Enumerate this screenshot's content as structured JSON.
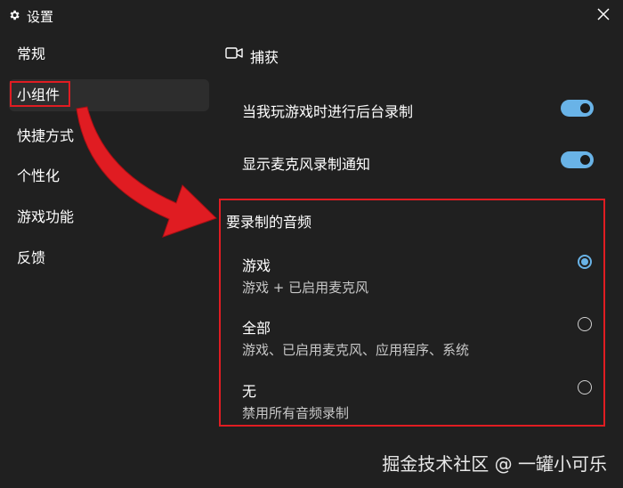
{
  "window": {
    "title": "设置"
  },
  "sidebar": {
    "items": [
      {
        "label": "常规"
      },
      {
        "label": "小组件"
      },
      {
        "label": "快捷方式"
      },
      {
        "label": "个性化"
      },
      {
        "label": "游戏功能"
      },
      {
        "label": "反馈"
      }
    ],
    "active_index": 1
  },
  "main": {
    "section_title": "捕获",
    "settings": [
      {
        "label": "当我玩游戏时进行后台录制",
        "enabled": true
      },
      {
        "label": "显示麦克风录制通知",
        "enabled": true
      }
    ],
    "audio": {
      "title": "要录制的音频",
      "options": [
        {
          "label": "游戏",
          "description": "游戏 + 已启用麦克风",
          "selected": true
        },
        {
          "label": "全部",
          "description": "游戏、已启用麦克风、应用程序、系统",
          "selected": false
        },
        {
          "label": "无",
          "description": "禁用所有音频录制",
          "selected": false
        }
      ]
    }
  },
  "watermark": "掘金技术社区 @ 一罐小可乐",
  "colors": {
    "background": "#202020",
    "active_nav": "#2d2d2d",
    "accent": "#69b3e7",
    "annotation_red": "#e01c22"
  },
  "icons": {
    "title": "gear-icon",
    "close": "close-icon",
    "section": "camera-icon"
  }
}
